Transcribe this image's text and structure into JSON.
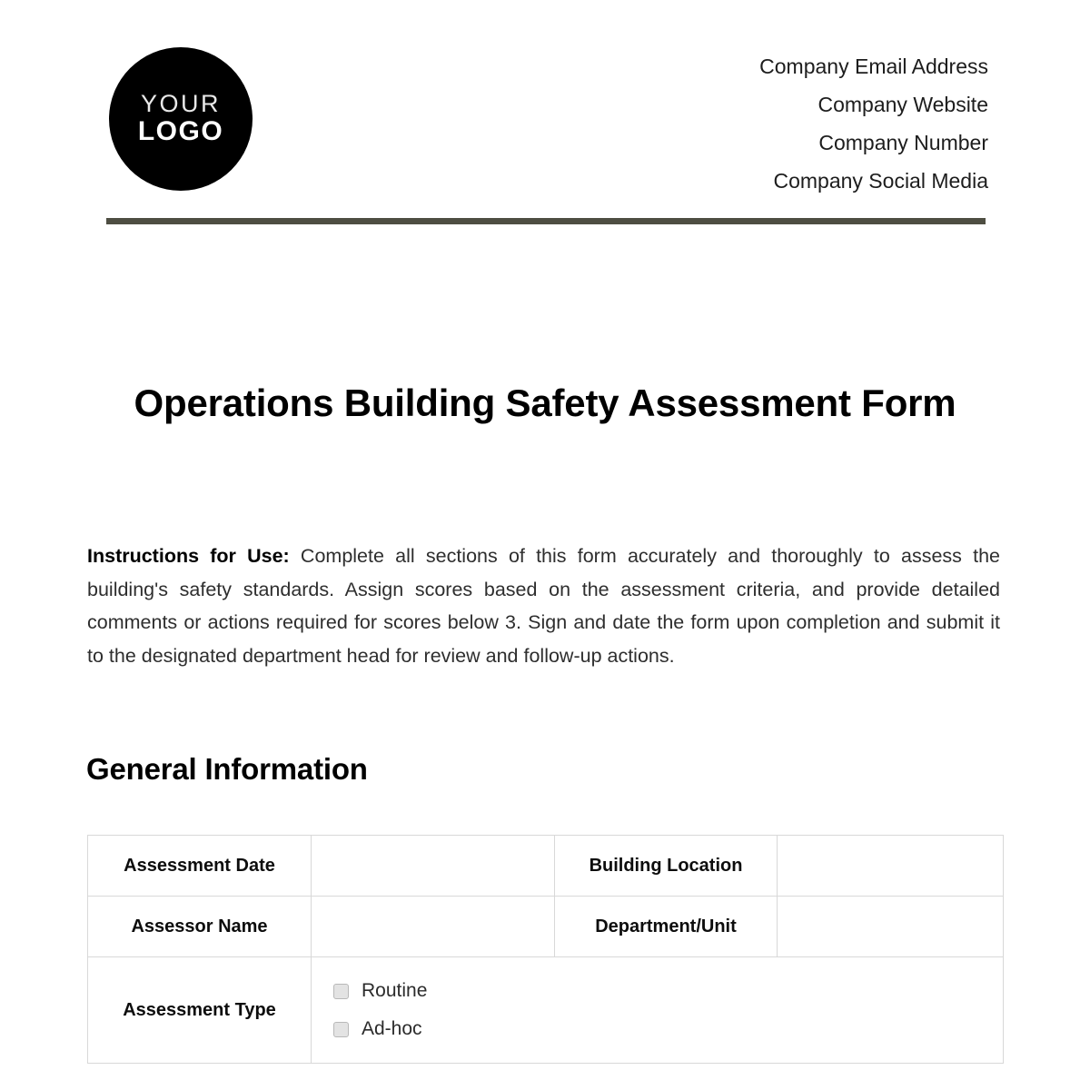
{
  "header": {
    "logo": {
      "line1": "YOUR",
      "line2": "LOGO"
    },
    "company_lines": [
      "Company Email Address",
      "Company Website",
      "Company Number",
      "Company Social Media"
    ]
  },
  "document": {
    "title": "Operations Building Safety Assessment Form",
    "instructions_lead": "Instructions for Use:",
    "instructions_body": " Complete all sections of this form accurately and thoroughly to assess the building's safety standards. Assign scores based on the assessment criteria, and provide detailed comments or actions required for scores below 3. Sign and date the form upon completion and submit it to the designated department head for review and follow-up actions."
  },
  "general_information": {
    "heading": "General Information",
    "rows": [
      {
        "label_left": "Assessment Date",
        "value_left": "",
        "label_right": "Building Location",
        "value_right": ""
      },
      {
        "label_left": "Assessor Name",
        "value_left": "",
        "label_right": "Department/Unit",
        "value_right": ""
      }
    ],
    "assessment_type": {
      "label": "Assessment Type",
      "options": [
        {
          "label": "Routine",
          "checked": false
        },
        {
          "label": "Ad-hoc",
          "checked": false
        }
      ]
    }
  },
  "colors": {
    "rule": "#4e4e42",
    "logo_background": "#000000",
    "table_border": "#d8d8d8",
    "checkbox_fill": "#e3e3e3",
    "body_text": "#2e2e2e"
  }
}
